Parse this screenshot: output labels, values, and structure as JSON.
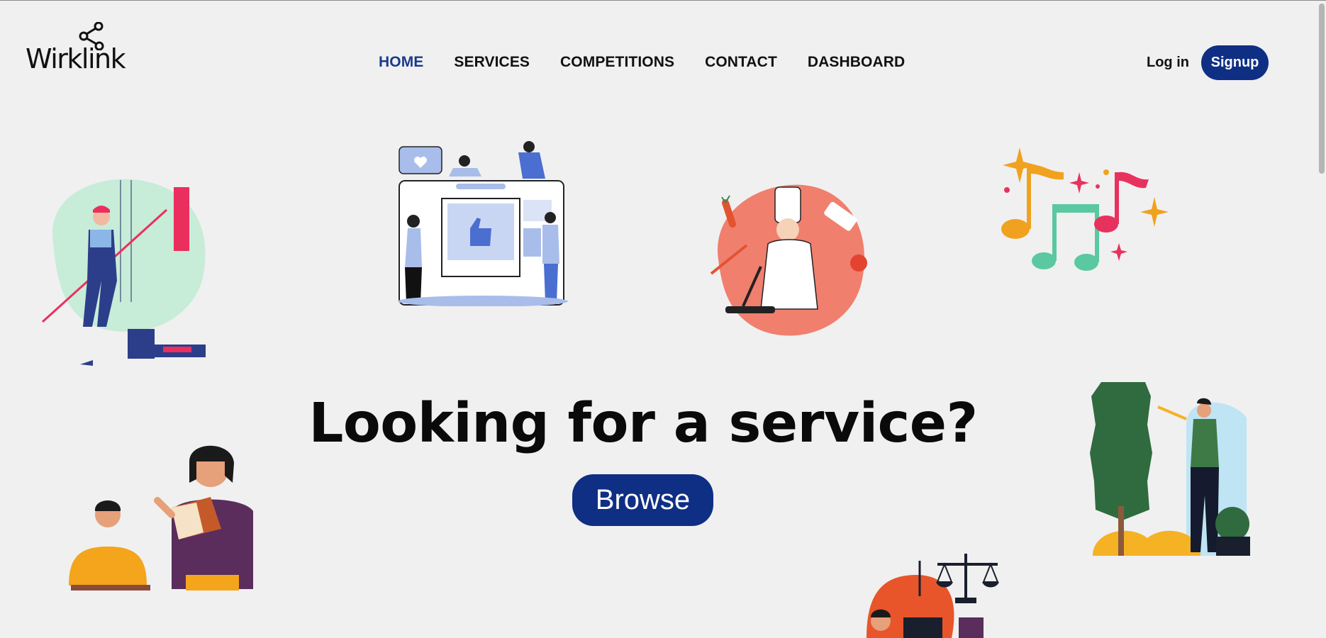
{
  "brand": {
    "name": "Wirklink"
  },
  "nav": {
    "items": [
      {
        "label": "HOME",
        "active": true
      },
      {
        "label": "SERVICES"
      },
      {
        "label": "COMPETITIONS"
      },
      {
        "label": "CONTACT"
      },
      {
        "label": "DASHBOARD"
      }
    ]
  },
  "auth": {
    "login_label": "Log in",
    "signup_label": "Signup"
  },
  "hero": {
    "headline": "Looking for a service?",
    "browse_label": "Browse"
  },
  "illustrations": [
    "painter-illustration",
    "social-media-illustration",
    "chef-illustration",
    "music-notes-illustration",
    "tutoring-illustration",
    "gardener-illustration",
    "legal-services-illustration"
  ],
  "colors": {
    "primary": "#0f2f84",
    "active_nav": "#1b3a8a",
    "background": "#f0f0f0"
  }
}
